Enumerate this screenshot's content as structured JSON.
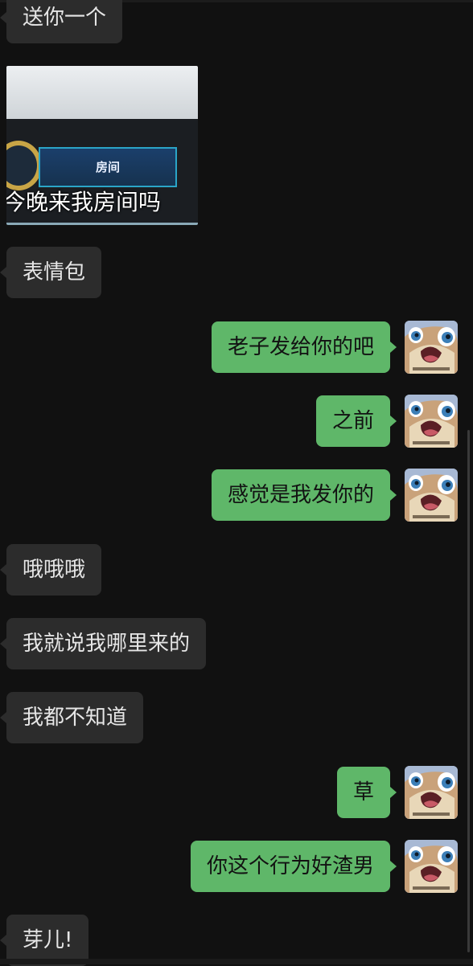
{
  "chat": {
    "messages": [
      {
        "side": "in",
        "type": "text",
        "text": "送你一个"
      },
      {
        "side": "in",
        "type": "sticker",
        "game_label": "房间",
        "caption": "今晚来我房间吗"
      },
      {
        "side": "in",
        "type": "text",
        "text": "表情包"
      },
      {
        "side": "out",
        "type": "text",
        "text": "老子发给你的吧"
      },
      {
        "side": "out",
        "type": "text",
        "text": "之前"
      },
      {
        "side": "out",
        "type": "text",
        "text": "感觉是我发你的"
      },
      {
        "side": "in",
        "type": "text",
        "text": "哦哦哦"
      },
      {
        "side": "in",
        "type": "text",
        "text": "我就说我哪里来的"
      },
      {
        "side": "in",
        "type": "text",
        "text": "我都不知道"
      },
      {
        "side": "out",
        "type": "text",
        "text": "草"
      },
      {
        "side": "out",
        "type": "text",
        "text": "你这个行为好渣男"
      },
      {
        "side": "in",
        "type": "text",
        "text": "芽儿!"
      }
    ]
  },
  "colors": {
    "background": "#111111",
    "incoming_bubble": "#2c2c2c",
    "outgoing_bubble": "#5fb769"
  },
  "icons": {
    "self_avatar": "cartoon-creature-avatar"
  }
}
